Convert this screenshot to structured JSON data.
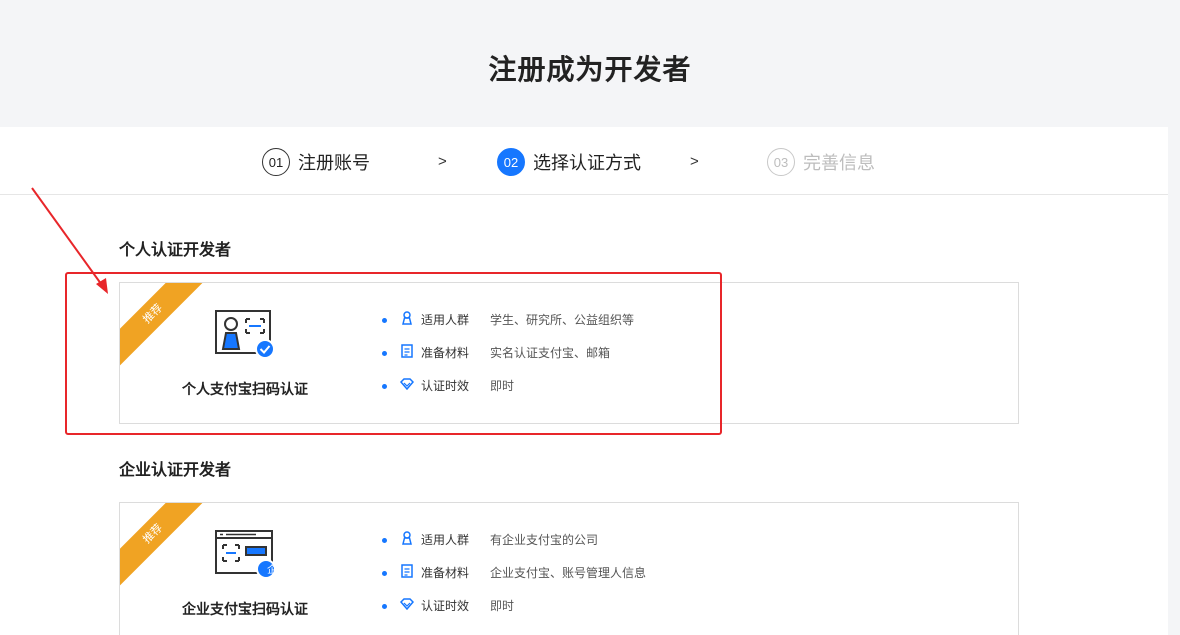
{
  "page": {
    "title": "注册成为开发者"
  },
  "steps": [
    {
      "num": "01",
      "label": "注册账号"
    },
    {
      "num": "02",
      "label": "选择认证方式"
    },
    {
      "num": "03",
      "label": "完善信息"
    }
  ],
  "step_separator": ">",
  "personal": {
    "section_title": "个人认证开发者",
    "badge": "推荐",
    "name": "个人支付宝扫码认证",
    "rows": [
      {
        "label": "适用人群",
        "value": "学生、研究所、公益组织等"
      },
      {
        "label": "准备材料",
        "value": "实名认证支付宝、邮箱"
      },
      {
        "label": "认证时效",
        "value": "即时"
      }
    ]
  },
  "enterprise": {
    "section_title": "企业认证开发者",
    "badge": "推荐",
    "name": "企业支付宝扫码认证",
    "icon_badge": "企",
    "rows": [
      {
        "label": "适用人群",
        "value": "有企业支付宝的公司"
      },
      {
        "label": "准备材料",
        "value": "企业支付宝、账号管理人信息"
      },
      {
        "label": "认证时效",
        "value": "即时"
      }
    ]
  },
  "colors": {
    "accent": "#1677ff",
    "ribbon": "#f0a323",
    "highlight": "#e8262a"
  }
}
